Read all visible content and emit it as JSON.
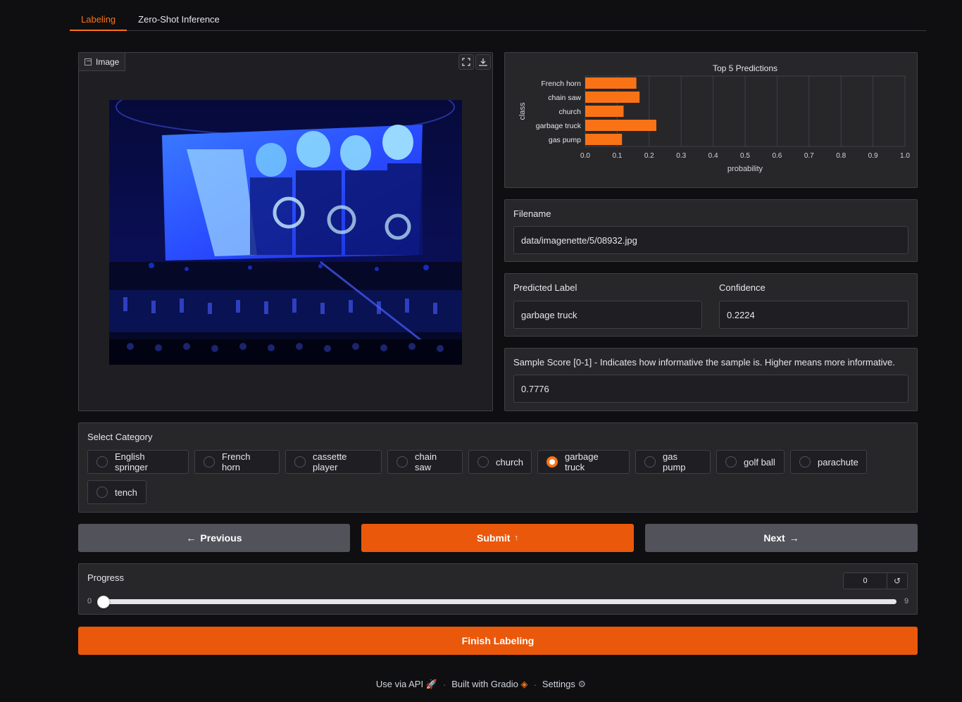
{
  "tabs": [
    "Labeling",
    "Zero-Shot Inference"
  ],
  "image_panel": {
    "label": "Image"
  },
  "chart_data": {
    "type": "bar",
    "title": "Top 5 Predictions",
    "categories": [
      "French horn",
      "chain saw",
      "church",
      "garbage truck",
      "gas pump"
    ],
    "values": [
      0.16,
      0.17,
      0.12,
      0.2224,
      0.115
    ],
    "xlabel": "probability",
    "ylabel": "class",
    "xlim": [
      0,
      1
    ],
    "xticks": [
      "0.0",
      "0.1",
      "0.2",
      "0.3",
      "0.4",
      "0.5",
      "0.6",
      "0.7",
      "0.8",
      "0.9",
      "1.0"
    ],
    "orientation": "horizontal",
    "color": "#f97316",
    "grid": true
  },
  "filename": {
    "label": "Filename",
    "value": "data/imagenette/5/08932.jpg"
  },
  "predicted": {
    "label": "Predicted Label",
    "value": "garbage truck"
  },
  "confidence": {
    "label": "Confidence",
    "value": "0.2224"
  },
  "sample_score": {
    "label": "Sample Score [0-1] - Indicates how informative the sample is. Higher means more informative.",
    "value": "0.7776"
  },
  "category": {
    "label": "Select Category",
    "options": [
      "English springer",
      "French horn",
      "cassette player",
      "chain saw",
      "church",
      "garbage truck",
      "gas pump",
      "golf ball",
      "parachute",
      "tench"
    ],
    "selected": "garbage truck"
  },
  "buttons": {
    "previous": "Previous",
    "submit": "Submit",
    "next": "Next",
    "finish": "Finish Labeling"
  },
  "progress": {
    "label": "Progress",
    "value": "0",
    "min": "0",
    "max": "9",
    "fraction": 0.0
  },
  "footer": {
    "api": "Use via API",
    "built": "Built with Gradio",
    "settings": "Settings"
  },
  "colors": {
    "accent": "#f97316",
    "primary_button": "#ea580c"
  }
}
